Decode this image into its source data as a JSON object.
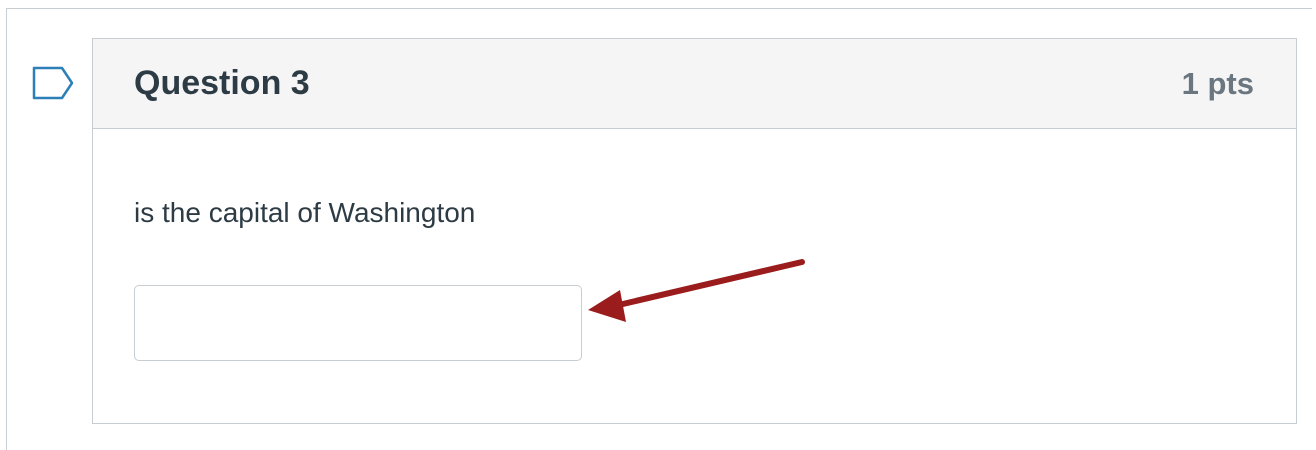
{
  "question": {
    "title": "Question 3",
    "points": "1 pts",
    "text": "is the capital of Washington",
    "answer_value": "",
    "answer_placeholder": ""
  },
  "icons": {
    "flag": "flag-icon",
    "annotation_arrow": "arrow-icon"
  },
  "colors": {
    "header_bg": "#f5f5f5",
    "border": "#c7cdd1",
    "title_text": "#2d3b45",
    "points_text": "#6b7780",
    "flag_stroke": "#2d7fb8",
    "arrow": "#9b1c1c"
  }
}
